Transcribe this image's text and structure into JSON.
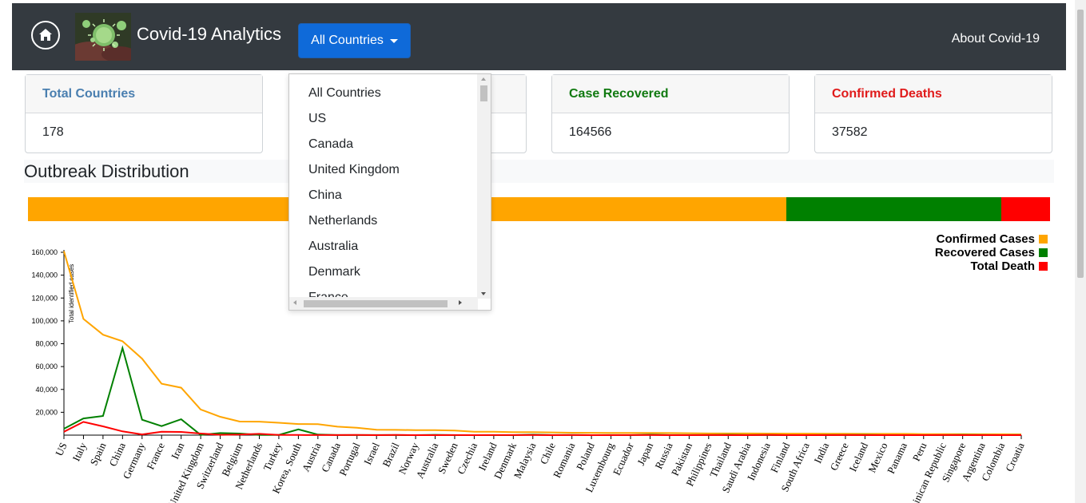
{
  "navbar": {
    "brand": "Covid-19 Analytics",
    "dropdown_label": "All Countries",
    "about": "About Covid-19"
  },
  "cards": [
    {
      "title": "Total Countries",
      "value": "178",
      "color": "#4a7fb0"
    },
    {
      "title": "",
      "value": "",
      "color": "#212529"
    },
    {
      "title": "Case Recovered",
      "value": "164566",
      "color": "#117a11"
    },
    {
      "title": "Confirmed Deaths",
      "value": "37582",
      "color": "#e01b1b"
    }
  ],
  "section_title": "Outbreak Distribution",
  "distribution": [
    {
      "name": "Confirmed Cases",
      "fraction": 0.742,
      "color": "#ffa500"
    },
    {
      "name": "Recovered Cases",
      "fraction": 0.21,
      "color": "#008000"
    },
    {
      "name": "Total Death",
      "fraction": 0.048,
      "color": "#ff0000"
    }
  ],
  "dropdown_menu": {
    "items": [
      "All Countries",
      "US",
      "Canada",
      "United Kingdom",
      "China",
      "Netherlands",
      "Australia",
      "Denmark",
      "France"
    ]
  },
  "chart_data": {
    "type": "line",
    "ylabel": "Total identified cases",
    "ylim": [
      0,
      160000
    ],
    "yticks": [
      "20,000",
      "40,000",
      "60,000",
      "80,000",
      "100,000",
      "120,000",
      "140,000",
      "160,000"
    ],
    "ytick_values": [
      20000,
      40000,
      60000,
      80000,
      100000,
      120000,
      140000,
      160000
    ],
    "categories": [
      "US",
      "Italy",
      "Spain",
      "China",
      "Germany",
      "France",
      "Iran",
      "United Kingdom",
      "Switzerland",
      "Belgium",
      "Netherlands",
      "Turkey",
      "Korea, South",
      "Austria",
      "Canada",
      "Portugal",
      "Israel",
      "Brazil",
      "Norway",
      "Australia",
      "Sweden",
      "Czechia",
      "Ireland",
      "Denmark",
      "Malaysia",
      "Chile",
      "Romania",
      "Poland",
      "Luxembourg",
      "Ecuador",
      "Japan",
      "Russia",
      "Pakistan",
      "Philippines",
      "Thailand",
      "Saudi Arabia",
      "Indonesia",
      "Finland",
      "South Africa",
      "India",
      "Greece",
      "Iceland",
      "Mexico",
      "Panama",
      "Peru",
      "Dominican Republic",
      "Singapore",
      "Argentina",
      "Colombia",
      "Croatia"
    ],
    "series": [
      {
        "name": "Confirmed Cases",
        "color": "#ffa500",
        "values": [
          161000,
          101700,
          87900,
          82200,
          66900,
          45000,
          41500,
          22400,
          16100,
          11900,
          11800,
          10800,
          9700,
          9600,
          7400,
          6400,
          4700,
          4600,
          4400,
          4300,
          4000,
          3000,
          2900,
          2600,
          2600,
          2400,
          2100,
          2000,
          1900,
          1900,
          1900,
          1800,
          1700,
          1500,
          1500,
          1500,
          1400,
          1300,
          1300,
          1200,
          1200,
          1100,
          1100,
          1100,
          900,
          900,
          900,
          800,
          800,
          700
        ]
      },
      {
        "name": "Recovered Cases",
        "color": "#008000",
        "values": [
          5600,
          14600,
          16800,
          76200,
          13500,
          7900,
          13900,
          200,
          1800,
          1400,
          200,
          200,
          5000,
          500,
          100,
          40,
          100,
          100,
          10,
          300,
          20,
          20,
          5,
          1,
          400,
          100,
          200,
          10,
          40,
          30,
          400,
          100,
          40,
          40,
          300,
          70,
          80,
          10,
          30,
          100,
          50,
          150,
          10,
          10,
          20,
          10,
          200,
          70,
          20,
          60
        ]
      },
      {
        "name": "Total Death",
        "color": "#ff0000",
        "values": [
          2900,
          11600,
          7700,
          3300,
          600,
          3000,
          2800,
          1400,
          300,
          500,
          1100,
          200,
          160,
          100,
          100,
          140,
          20,
          160,
          30,
          20,
          100,
          20,
          50,
          70,
          40,
          10,
          40,
          30,
          20,
          90,
          50,
          10,
          20,
          80,
          10,
          10,
          120,
          10,
          5,
          30,
          40,
          5,
          20,
          30,
          20,
          50,
          5,
          20,
          10,
          10
        ]
      }
    ]
  },
  "legend": {
    "items": [
      {
        "label": "Confirmed Cases",
        "color": "#ffa500"
      },
      {
        "label": "Recovered Cases",
        "color": "#008000"
      },
      {
        "label": "Total Death",
        "color": "#ff0000"
      }
    ]
  }
}
